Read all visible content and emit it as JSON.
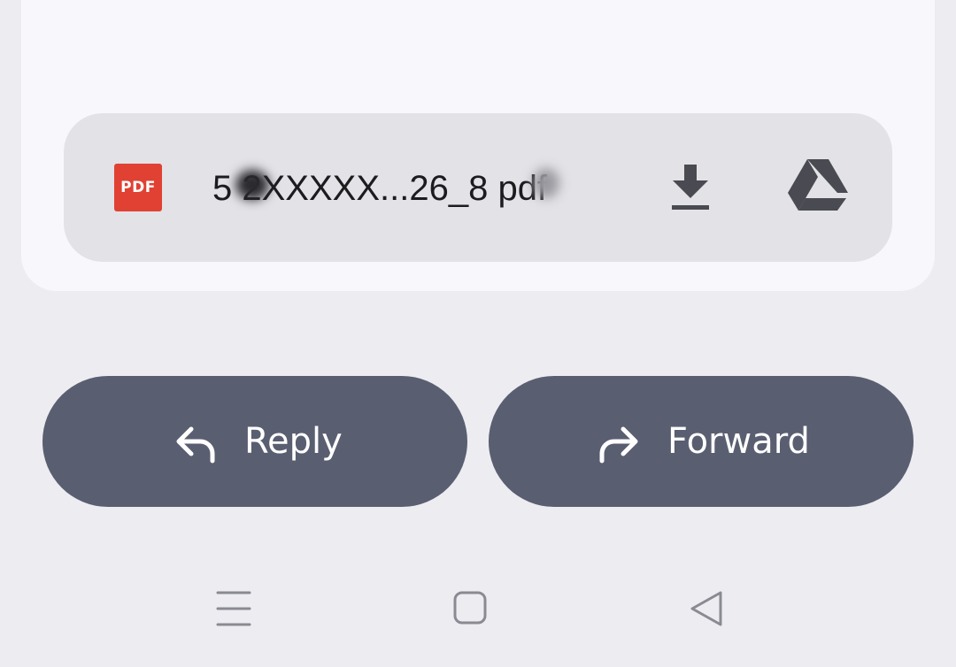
{
  "attachment": {
    "type_label": "PDF",
    "filename": "5   2XXXXX...26_8    pdf",
    "download_icon": "download-icon",
    "drive_icon": "google-drive-icon"
  },
  "actions": {
    "reply_label": "Reply",
    "reply_icon": "reply-arrow-icon",
    "forward_label": "Forward",
    "forward_icon": "forward-arrow-icon"
  },
  "navbar": {
    "menu_icon": "recent-apps-icon",
    "home_icon": "home-icon",
    "back_icon": "back-icon"
  },
  "colors": {
    "background": "#edecf1",
    "card": "#f7f7fc",
    "attachment_chip": "#e2e2e7",
    "pdf_badge": "#e04132",
    "action_button": "#5a5e71",
    "icon_dark": "#4a4a52",
    "nav_icon": "#8a8a92"
  }
}
